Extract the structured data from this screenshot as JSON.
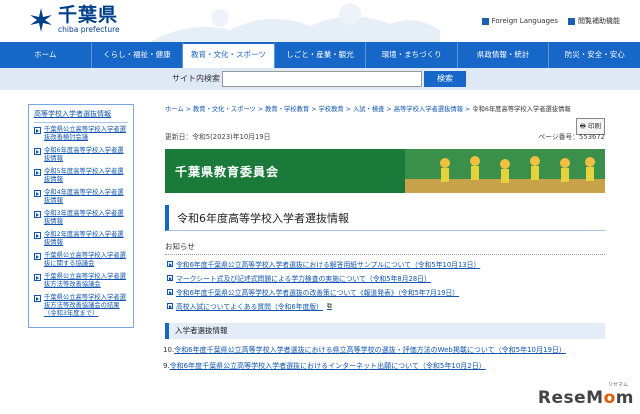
{
  "header": {
    "logo_ja": "千葉県",
    "logo_en": "chiba prefecture",
    "links": [
      "Foreign Languages",
      "閲覧補助機能"
    ]
  },
  "nav": {
    "items": [
      "ホーム",
      "くらし・福祉・健康",
      "教育・文化・スポーツ",
      "しごと・産業・観光",
      "環境・まちづくり",
      "県政情報・統計",
      "防災・安全・安心"
    ]
  },
  "search": {
    "label": "サイト内検索",
    "value": "",
    "button": "検索"
  },
  "sidebar": {
    "title": "高等学校入学者選抜情報",
    "items": [
      "千葉県公立高等学校入学者選抜改善検討会議",
      "令和6年度高等学校入学者選抜情報",
      "令和5年度高等学校入学者選抜情報",
      "令和4年度高等学校入学者選抜情報",
      "令和3年度高等学校入学者選抜情報",
      "令和2年度高等学校入学者選抜情報",
      "千葉県公立高等学校入学者選抜に関する協議会",
      "千葉県公立高等学校入学者選抜方法等改善協議会",
      "千葉県公立高等学校入学者選抜方法等改善協議会の結果（令和3年度まで）"
    ]
  },
  "main": {
    "breadcrumb": [
      "ホーム",
      "教育・文化・スポーツ",
      "教育・学校教育",
      "学校教育",
      "入試・検査",
      "高等学校入学者選抜情報"
    ],
    "breadcrumb_current": "令和6年度高等学校入学者選抜情報",
    "print": "印刷",
    "updated": "更新日：令和5(2023)年10月19日",
    "page_number": "ページ番号：553672",
    "banner": "千葉県教育委員会",
    "title": "令和6年度高等学校入学者選抜情報",
    "notice_head": "お知らせ",
    "notices": [
      "令和6年度千葉県公立高等学校入学者選抜における解答用紙サンプルについて（令和5年10月13日）",
      "マークシート式及び記述式問題による学力検査の実施について（令和5年8月28日）",
      "令和6年度千葉県公立高等学校入学者選抜の改善策について《報道発表》（令和5年7月19日）",
      "高校入試についてよくある質問（令和6年度版）"
    ],
    "section_head": "入学者選抜情報",
    "entries": [
      {
        "no": "10.",
        "text": "令和6年度千葉県公立高等学校入学者選抜における県立高等学校の選抜・評価方法のWeb掲載について（令和5年10月19日）"
      },
      {
        "no": "9.",
        "text": "令和6年度千葉県公立高等学校入学者選抜におけるインターネット出願について（令和5年10月2日）"
      }
    ]
  },
  "watermark": {
    "sub": "リセマム",
    "main_pre": "ReseM",
    "main_o": "o",
    "main_post": "m"
  },
  "colors": {
    "nav_blue": "#1667c8",
    "banner_green": "#1a7a3a",
    "link_blue": "#1155b0"
  }
}
